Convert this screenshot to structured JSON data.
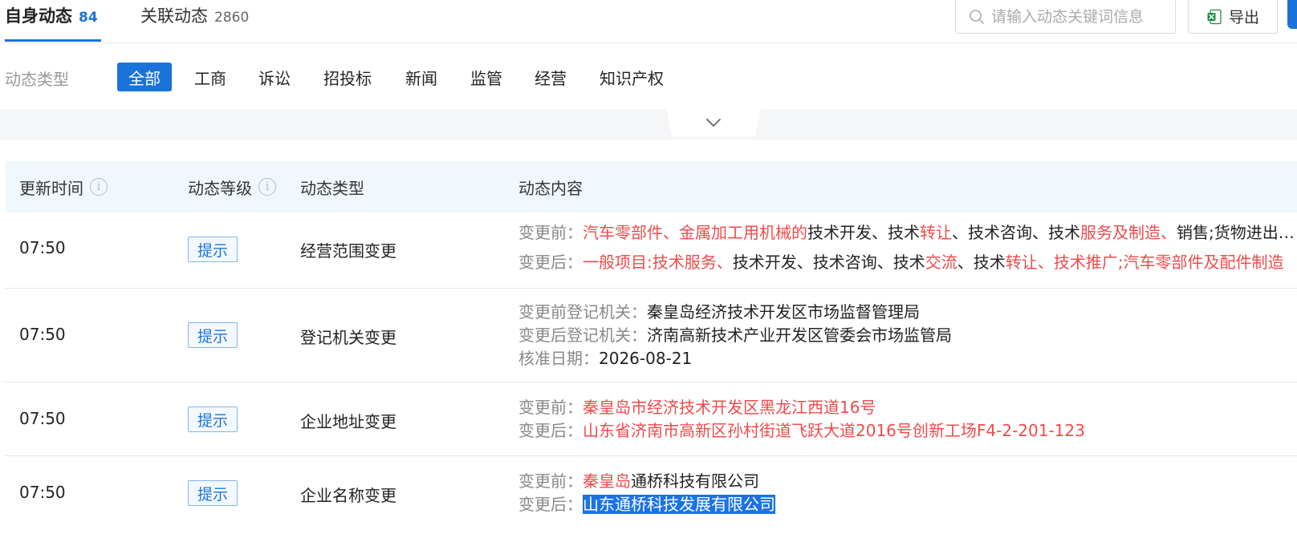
{
  "tabs": [
    {
      "label": "自身动态",
      "count": "84"
    },
    {
      "label": "关联动态",
      "count": "2860"
    }
  ],
  "search": {
    "placeholder": "请输入动态关键词信息"
  },
  "export_label": "导出",
  "filter": {
    "label": "动态类型",
    "options": [
      "全部",
      "工商",
      "诉讼",
      "招投标",
      "新闻",
      "监管",
      "经营",
      "知识产权"
    ]
  },
  "table": {
    "headers": [
      "更新时间",
      "动态等级",
      "动态类型",
      "动态内容"
    ],
    "rows": [
      {
        "time": "07:50",
        "level": "提示",
        "type": "经营范围变更",
        "lines": [
          {
            "label": "变更前：",
            "segments": [
              {
                "text": "汽车零部件、金属加工用机械的",
                "style": "red"
              },
              {
                "text": "技术开发、技术",
                "style": "normal"
              },
              {
                "text": "转让",
                "style": "red"
              },
              {
                "text": "、技术咨询、技术",
                "style": "normal"
              },
              {
                "text": "服务及制造、",
                "style": "red"
              },
              {
                "text": "销售;货物进出口、技术进出口",
                "style": "normal"
              }
            ]
          },
          {
            "label": "变更后：",
            "segments": [
              {
                "text": "一般项目:技术服务、",
                "style": "red"
              },
              {
                "text": "技术开发、技术咨询、技术",
                "style": "normal"
              },
              {
                "text": "交流",
                "style": "red"
              },
              {
                "text": "、技术",
                "style": "normal"
              },
              {
                "text": "转让、技术推广;汽车零部件及配件制造",
                "style": "red"
              }
            ]
          }
        ]
      },
      {
        "time": "07:50",
        "level": "提示",
        "type": "登记机关变更",
        "lines": [
          {
            "label": "变更前登记机关：",
            "segments": [
              {
                "text": "秦皇岛经济技术开发区市场监督管理局",
                "style": "normal"
              }
            ]
          },
          {
            "label": "变更后登记机关：",
            "segments": [
              {
                "text": "济南高新技术产业开发区管委会市场监管局",
                "style": "normal"
              }
            ]
          },
          {
            "label": "核准日期：",
            "segments": [
              {
                "text": "2026-08-21",
                "style": "normal"
              }
            ]
          }
        ]
      },
      {
        "time": "07:50",
        "level": "提示",
        "type": "企业地址变更",
        "lines": [
          {
            "label": "变更前：",
            "segments": [
              {
                "text": "秦皇岛市经济技术开发区黑龙江西道16号",
                "style": "red"
              }
            ]
          },
          {
            "label": "变更后：",
            "segments": [
              {
                "text": "山东省济南市高新区孙村街道飞跃大道2016号创新工场F4-2-201-123",
                "style": "red"
              }
            ]
          }
        ]
      },
      {
        "time": "07:50",
        "level": "提示",
        "type": "企业名称变更",
        "lines": [
          {
            "label": "变更前：",
            "segments": [
              {
                "text": "秦皇岛",
                "style": "red"
              },
              {
                "text": "通桥科技有限公司",
                "style": "normal"
              }
            ]
          },
          {
            "label": "变更后：",
            "segments": [
              {
                "text": "山东通桥科技发展有限公司",
                "style": "highlight"
              }
            ]
          }
        ]
      }
    ]
  },
  "colors": {
    "accent": "#1a73d8",
    "change": "#f04a4a",
    "header_bg": "#f0f7fd"
  }
}
